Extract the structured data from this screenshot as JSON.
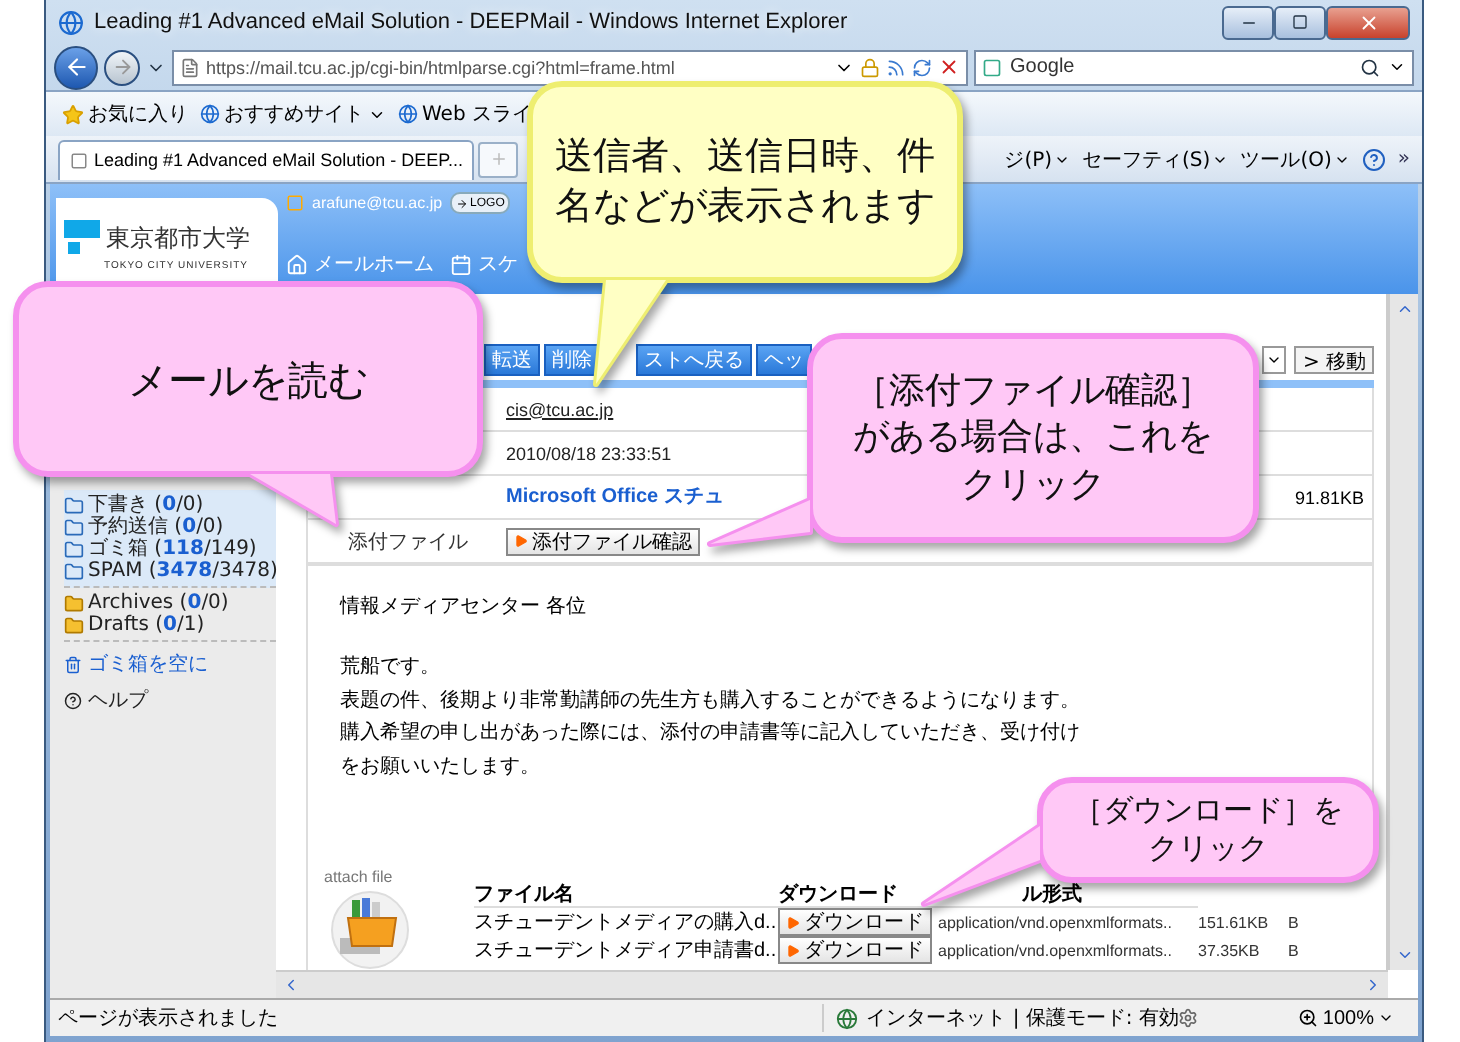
{
  "window": {
    "title": "Leading #1 Advanced eMail Solution - DEEPMail - Windows Internet Explorer"
  },
  "address_bar": {
    "url": "https://mail.tcu.ac.jp/cgi-bin/htmlparse.cgi?html=frame.html"
  },
  "search": {
    "value": "Google"
  },
  "favorites_bar": {
    "favorites": "お気に入り",
    "suggested": "おすすめサイト",
    "web_slice": "Web スライ"
  },
  "tab_bar": {
    "tabs": [
      {
        "label": "Leading #1 Advanced eMail Solution - DEEP...",
        "selected": true
      }
    ],
    "commands": [
      "ジ(P)",
      "セーフティ(S)",
      "ツール(O)"
    ],
    "more": "»"
  },
  "mail": {
    "user": "arafune@tcu.ac.jp",
    "logout": "LOGO",
    "logo": {
      "name": "東京都市大学",
      "subtitle": "TOKYO CITY UNIVERSITY"
    },
    "nav": [
      {
        "label": "メールホーム",
        "kind": "home"
      },
      {
        "label": "スケ",
        "kind": "schedule"
      }
    ],
    "folders": [
      {
        "label": "下書き (**0**/0)",
        "kind": "mail"
      },
      {
        "label": "予約送信 (**0**/0)",
        "kind": "mail"
      },
      {
        "label": "ゴミ箱 (**118**/149)",
        "kind": "mail"
      },
      {
        "label": "SPAM (**3478**/3478)",
        "kind": "mail"
      },
      {
        "label": "Archives (**0**/0)",
        "kind": "local"
      },
      {
        "label": "Drafts (**0**/1)",
        "kind": "local"
      }
    ],
    "empty_trash": "ゴミ箱を空に",
    "help": "ヘルプ",
    "toolbar": [
      "転送",
      "削除",
      "ストへ戻る",
      "ヘッ"
    ],
    "move": "> 移動",
    "header": {
      "from": "cis@tcu.ac.jp",
      "date": "2010/08/18 23:33:51",
      "subject": "Microsoft Office スチュ",
      "size": "91.81KB",
      "attachment_label": "添付ファイル",
      "attachment_button": "添付ファイル確認"
    },
    "message": {
      "greeting": "情報メディアセンター 各位",
      "lines": [
        "荒船です。",
        "表題の件、後期より非常勤講師の先生方も購入することができるようになります。",
        "購入希望の申し出があった際には、添付の申請書等に記入していただき、受け付け",
        "をお願いいたします。"
      ]
    },
    "attachments": {
      "title": "attach file",
      "columns": [
        "ファイル名",
        "ダウンロード",
        "ル形式"
      ],
      "rows": [
        {
          "name": "スチューデントメディアの購入d..",
          "download": "ダウンロード",
          "type": "application/vnd.openxmlformats..",
          "size": "151.61KB",
          "column_5": "B"
        },
        {
          "name": "スチューデントメディア申請書d..",
          "download": "ダウンロード",
          "type": "application/vnd.openxmlformats..",
          "size": "37.35KB",
          "column_5": "B"
        }
      ]
    }
  },
  "status_bar": {
    "text": "ページが表示されました",
    "zone": "インターネット | 保護モード: 有効",
    "zoom": "100%"
  },
  "callouts": [
    {
      "kind": "note",
      "lines": [
        "送信者、送信日時、件",
        "名などが表示されます"
      ]
    },
    {
      "kind": "tip",
      "lines": [
        "メールを読む"
      ]
    },
    {
      "kind": "tip",
      "lines": [
        "［添付ファイル確認］",
        "がある場合は、これを",
        "クリック"
      ]
    },
    {
      "kind": "tip",
      "lines": [
        "［ダウンロード］を",
        "クリック"
      ]
    }
  ]
}
